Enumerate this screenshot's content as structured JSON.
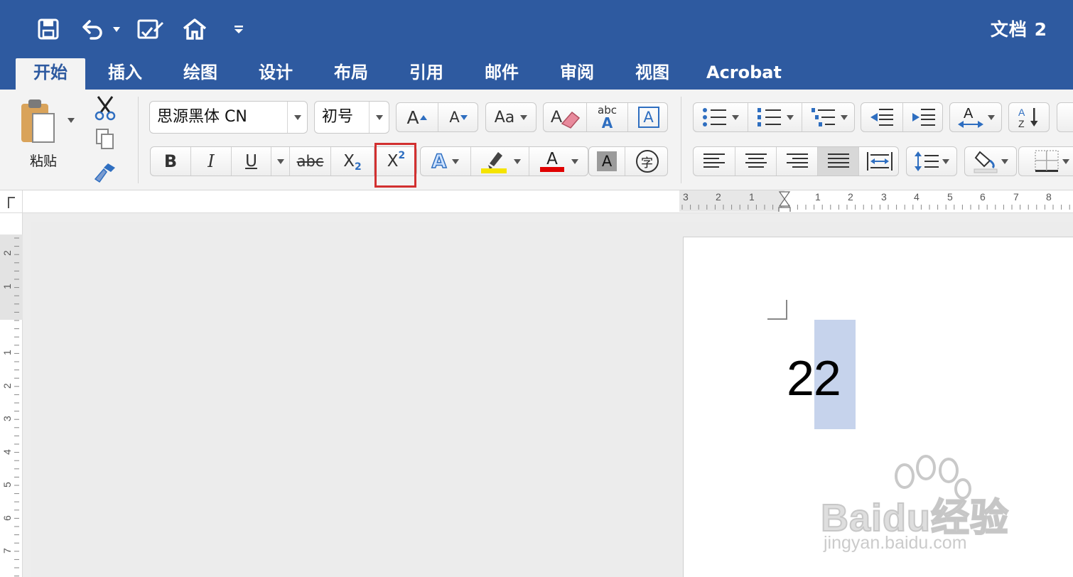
{
  "window": {
    "title": "文档 2"
  },
  "quick_access": {
    "icons": [
      "save-icon",
      "undo-icon",
      "undo-dropdown-icon",
      "edit-document-icon",
      "home-icon",
      "customize-toolbar-icon"
    ]
  },
  "tabs": [
    {
      "label": "开始",
      "active": true
    },
    {
      "label": "插入"
    },
    {
      "label": "绘图"
    },
    {
      "label": "设计"
    },
    {
      "label": "布局"
    },
    {
      "label": "引用"
    },
    {
      "label": "邮件"
    },
    {
      "label": "审阅"
    },
    {
      "label": "视图"
    },
    {
      "label": "Acrobat"
    }
  ],
  "clipboard": {
    "paste_label": "粘贴"
  },
  "font": {
    "name": "思源黑体 CN",
    "size": "初号",
    "bold": "B",
    "italic": "I",
    "underline": "U",
    "strikethrough": "abc",
    "subscript_base": "X",
    "subscript_sub": "2",
    "superscript_base": "X",
    "superscript_sup": "2",
    "clear_format_label": "abc",
    "text_effects_glyph": "A",
    "font_color_glyph": "A",
    "char_shading_glyph": "A",
    "enclose_glyph": "字",
    "grow_glyph": "A",
    "shrink_glyph": "A",
    "change_case_glyph": "Aa",
    "border_glyph": "A"
  },
  "colors": {
    "title_bar": "#2e5aa0",
    "highlight_yellow": "#f5e400",
    "font_red": "#e00000",
    "selection": "#c6d3ec",
    "callout_red": "#d23030"
  },
  "hruler": {
    "labels": [
      "3",
      "2",
      "1",
      "1",
      "2",
      "3",
      "4",
      "5",
      "6",
      "7",
      "8"
    ]
  },
  "vruler": {
    "labels": [
      "2",
      "1",
      "1",
      "2",
      "3",
      "4",
      "5",
      "6",
      "7"
    ]
  },
  "document": {
    "text": "22"
  },
  "watermark": {
    "brand": "Baidu经验",
    "url": "jingyan.baidu.com"
  }
}
